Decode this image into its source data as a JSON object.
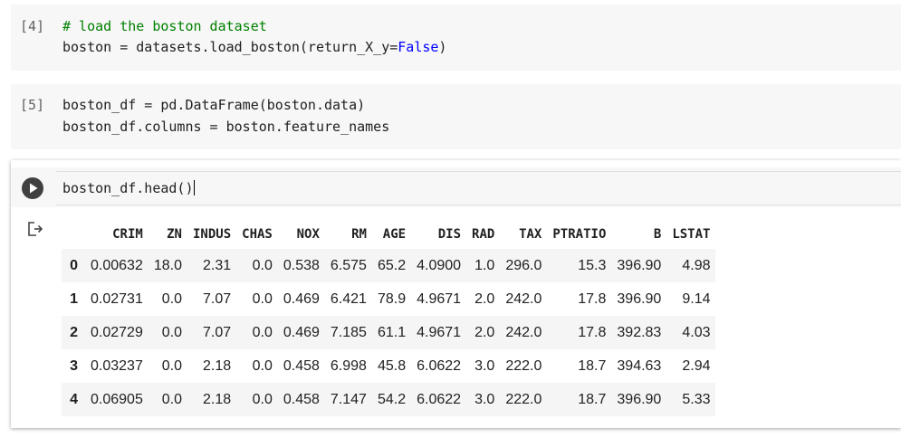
{
  "cells": [
    {
      "prompt": "[4]",
      "lines": [
        {
          "comment": "# load the boston dataset"
        },
        {
          "pre": "boston = datasets.load_boston(return_X_y=",
          "kw": "False",
          "post": ")"
        }
      ]
    },
    {
      "prompt": "[5]",
      "lines": [
        {
          "text": "boston_df = pd.DataFrame(boston.data)"
        },
        {
          "text": "boston_df.columns = boston.feature_names"
        }
      ]
    }
  ],
  "active_cell": {
    "code": "boston_df.head()",
    "run_icon": "play-icon",
    "output_icon": "output-arrow-icon"
  },
  "table": {
    "columns": [
      "CRIM",
      "ZN",
      "INDUS",
      "CHAS",
      "NOX",
      "RM",
      "AGE",
      "DIS",
      "RAD",
      "TAX",
      "PTRATIO",
      "B",
      "LSTAT"
    ],
    "rows": [
      {
        "index": "0",
        "values": [
          "0.00632",
          "18.0",
          "2.31",
          "0.0",
          "0.538",
          "6.575",
          "65.2",
          "4.0900",
          "1.0",
          "296.0",
          "15.3",
          "396.90",
          "4.98"
        ]
      },
      {
        "index": "1",
        "values": [
          "0.02731",
          "0.0",
          "7.07",
          "0.0",
          "0.469",
          "6.421",
          "78.9",
          "4.9671",
          "2.0",
          "242.0",
          "17.8",
          "396.90",
          "9.14"
        ]
      },
      {
        "index": "2",
        "values": [
          "0.02729",
          "0.0",
          "7.07",
          "0.0",
          "0.469",
          "7.185",
          "61.1",
          "4.9671",
          "2.0",
          "242.0",
          "17.8",
          "392.83",
          "4.03"
        ]
      },
      {
        "index": "3",
        "values": [
          "0.03237",
          "0.0",
          "2.18",
          "0.0",
          "0.458",
          "6.998",
          "45.8",
          "6.0622",
          "3.0",
          "222.0",
          "18.7",
          "394.63",
          "2.94"
        ]
      },
      {
        "index": "4",
        "values": [
          "0.06905",
          "0.0",
          "2.18",
          "0.0",
          "0.458",
          "7.147",
          "54.2",
          "6.0622",
          "3.0",
          "222.0",
          "18.7",
          "396.90",
          "5.33"
        ]
      }
    ]
  },
  "colors": {
    "comment": "#008000",
    "keyword": "#0000ff",
    "cell_bg": "#f7f7f7",
    "prompt": "#616161"
  }
}
